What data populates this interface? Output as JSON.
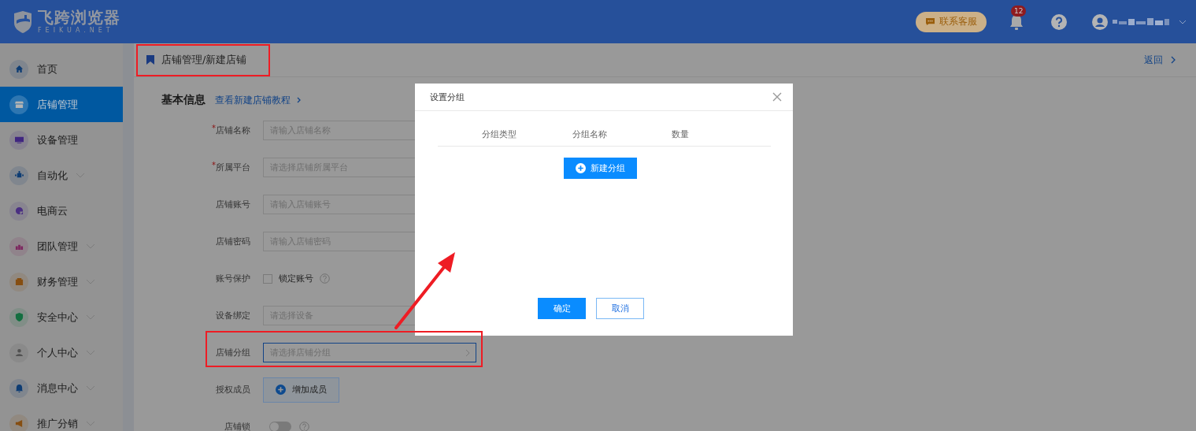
{
  "header": {
    "logo_name": "飞跨浏览器",
    "logo_sub": "FEIKUA.NET",
    "support_button": "联系客服",
    "notification_count": "12"
  },
  "sidebar": {
    "items": [
      {
        "label": "首页",
        "selected": false,
        "expandable": false,
        "color": "#0d3c73"
      },
      {
        "label": "店铺管理",
        "selected": true,
        "expandable": false,
        "color": "#b4b4b4"
      },
      {
        "label": "设备管理",
        "selected": false,
        "expandable": false,
        "color": "#402680"
      },
      {
        "label": "自动化",
        "selected": false,
        "expandable": true,
        "color": "#0d3c73"
      },
      {
        "label": "电商云",
        "selected": false,
        "expandable": false,
        "color": "#4a2f82"
      },
      {
        "label": "团队管理",
        "selected": false,
        "expandable": true,
        "color": "#7d265f"
      },
      {
        "label": "财务管理",
        "selected": false,
        "expandable": true,
        "color": "#864e11"
      },
      {
        "label": "安全中心",
        "selected": false,
        "expandable": true,
        "color": "#136f40"
      },
      {
        "label": "个人中心",
        "selected": false,
        "expandable": true,
        "color": "#525252"
      },
      {
        "label": "消息中心",
        "selected": false,
        "expandable": true,
        "color": "#0d3c73"
      },
      {
        "label": "推广分销",
        "selected": false,
        "expandable": true,
        "color": "#864e11"
      }
    ]
  },
  "breadcrumb": "店铺管理/新建店铺",
  "back_link": "返回",
  "form": {
    "section_title": "基本信息",
    "tutorial_link": "查看新建店铺教程",
    "fields": [
      {
        "kind": "input",
        "required_mark": "*",
        "label": "店铺名称",
        "placeholder": "请输入店铺名称",
        "focused": false
      },
      {
        "kind": "input",
        "required_mark": "*",
        "label": "所属平台",
        "placeholder": "请选择店铺所属平台",
        "focused": false
      },
      {
        "kind": "input",
        "label": "店铺账号",
        "placeholder": "请输入店铺账号",
        "focused": false
      },
      {
        "kind": "input",
        "label": "店铺密码",
        "placeholder": "请输入店铺密码",
        "focused": false
      },
      {
        "kind": "checkbox",
        "label": "账号保护",
        "option": "锁定账号",
        "checked": false
      },
      {
        "kind": "input",
        "label": "设备绑定",
        "placeholder": "请选择设备",
        "focused": false
      },
      {
        "kind": "select",
        "label": "店铺分组",
        "placeholder": "请选择店铺分组",
        "focused": true
      },
      {
        "kind": "button",
        "label": "授权成员",
        "button": "增加成员"
      },
      {
        "kind": "toggle",
        "label": "店铺锁",
        "on": false
      }
    ]
  },
  "dialog": {
    "title": "设置分组",
    "columns": [
      "分组类型",
      "分组名称",
      "数量"
    ],
    "new_button": "新建分组",
    "ok_button": "确定",
    "cancel_button": "取消"
  }
}
